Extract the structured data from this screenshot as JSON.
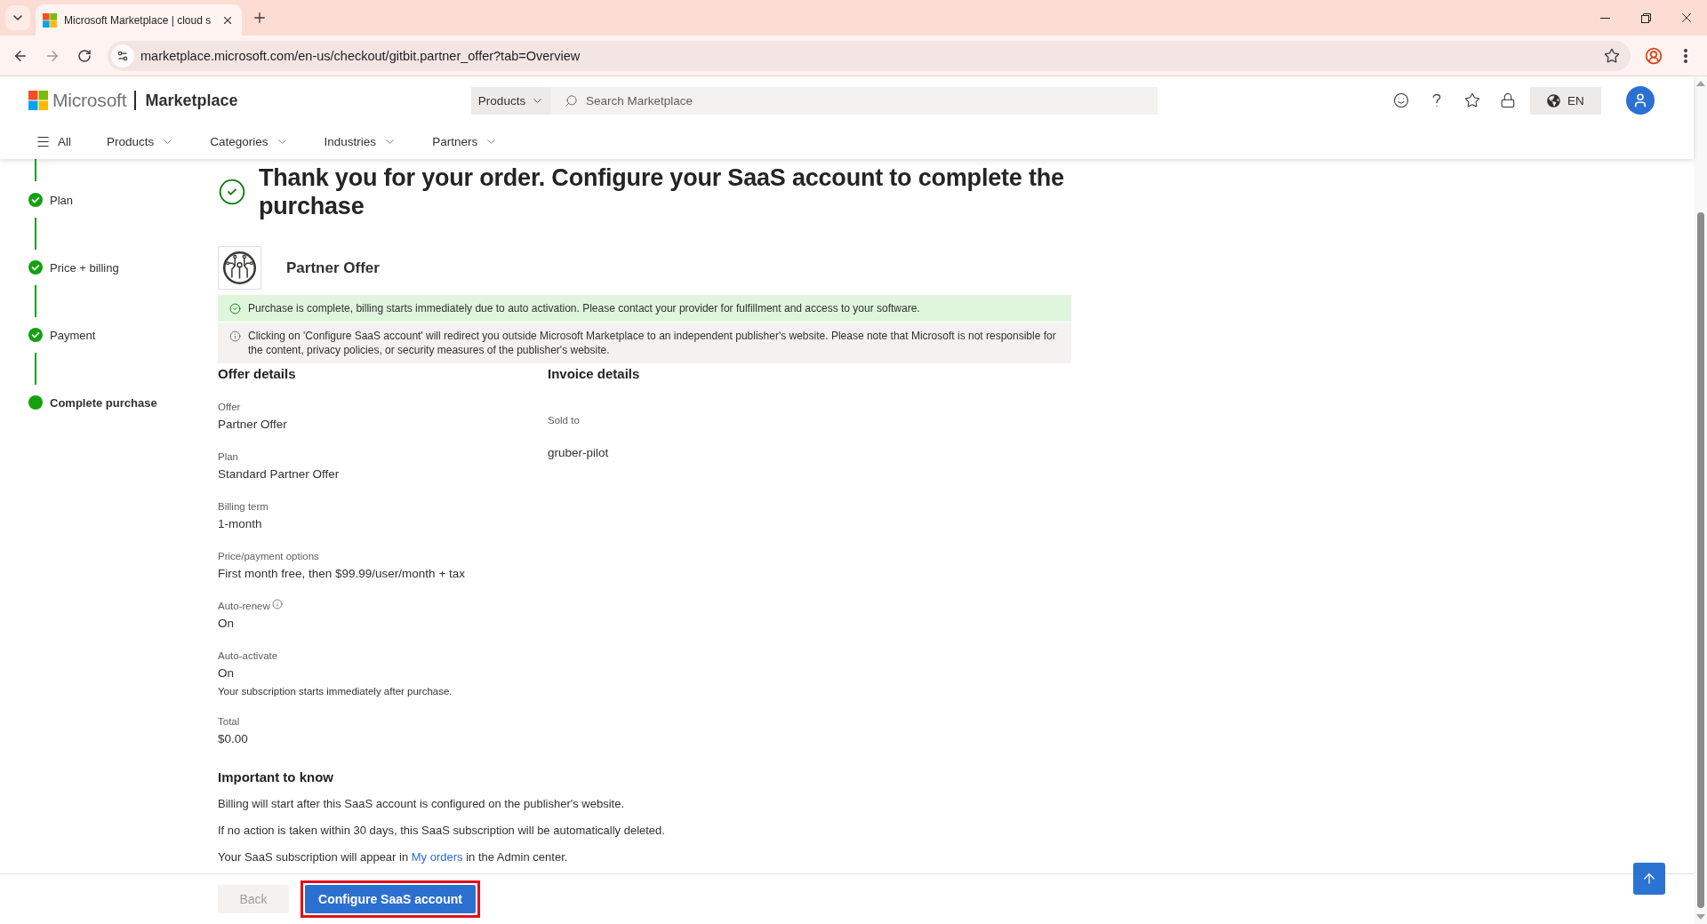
{
  "browser": {
    "tab_title": "Microsoft Marketplace | cloud s",
    "url": "marketplace.microsoft.com/en-us/checkout/gitbit.partner_offer?tab=Overview"
  },
  "header": {
    "brand": "Microsoft",
    "site": "Marketplace",
    "search_scope": "Products",
    "search": {
      "placeholder": "Search Marketplace"
    },
    "language": "EN"
  },
  "nav": {
    "menu": "All",
    "items": [
      "Products",
      "Categories",
      "Industries",
      "Partners"
    ]
  },
  "steps": [
    {
      "label": "Plan",
      "completed": true,
      "selected": false
    },
    {
      "label": "Price + billing",
      "completed": true,
      "selected": false
    },
    {
      "label": "Payment",
      "completed": true,
      "selected": false
    },
    {
      "label": "Complete purchase",
      "completed": false,
      "selected": true
    }
  ],
  "title": "Thank you for your order. Configure your SaaS account to complete the purchase",
  "offer": {
    "name": "Partner Offer"
  },
  "notices": [
    {
      "kind": "success",
      "text": "Purchase is complete, billing starts immediately due to auto activation. Please contact your provider for fulfillment and access to your software."
    },
    {
      "kind": "info",
      "text": "Clicking on 'Configure SaaS account' will redirect you outside Microsoft Marketplace to an independent publisher's website. Please note that Microsoft is not responsible for the content, privacy policies, or security measures of the publisher's website."
    }
  ],
  "offer_details": {
    "heading": "Offer details",
    "fields": [
      {
        "label": "Offer",
        "value": "Partner Offer",
        "info": false
      },
      {
        "label": "Plan",
        "value": "Standard Partner Offer",
        "info": false
      },
      {
        "label": "Billing term",
        "value": "1-month",
        "info": false
      },
      {
        "label": "Price/payment options",
        "value": "First month free, then $99.99/user/month + tax",
        "info": false
      },
      {
        "label": "Auto-renew",
        "value": "On",
        "info": true
      },
      {
        "label": "Auto-activate",
        "value": "On",
        "info": false,
        "note": "Your subscription starts immediately after purchase."
      },
      {
        "label": "Total",
        "value": "$0.00",
        "info": false
      }
    ]
  },
  "invoice_details": {
    "heading": "Invoice details",
    "fields": [
      {
        "label": "Sold to",
        "value": "gruber-pilot",
        "info": false
      }
    ]
  },
  "important": {
    "heading": "Important to know",
    "lines": [
      {
        "text": "Billing will start after this SaaS account is configured on the publisher's website."
      },
      {
        "text": "If no action is taken within 30 days, this SaaS subscription will be automatically deleted."
      },
      {
        "text": "Your SaaS subscription will appear in ",
        "link": "My orders",
        "text_after": " in the Admin center."
      }
    ]
  },
  "footer": {
    "buttons": [
      {
        "label": "Back",
        "kind": "secondary",
        "disabled": true,
        "highlighted": false
      },
      {
        "label": "Configure SaaS account",
        "kind": "primary",
        "disabled": false,
        "highlighted": true
      }
    ]
  }
}
